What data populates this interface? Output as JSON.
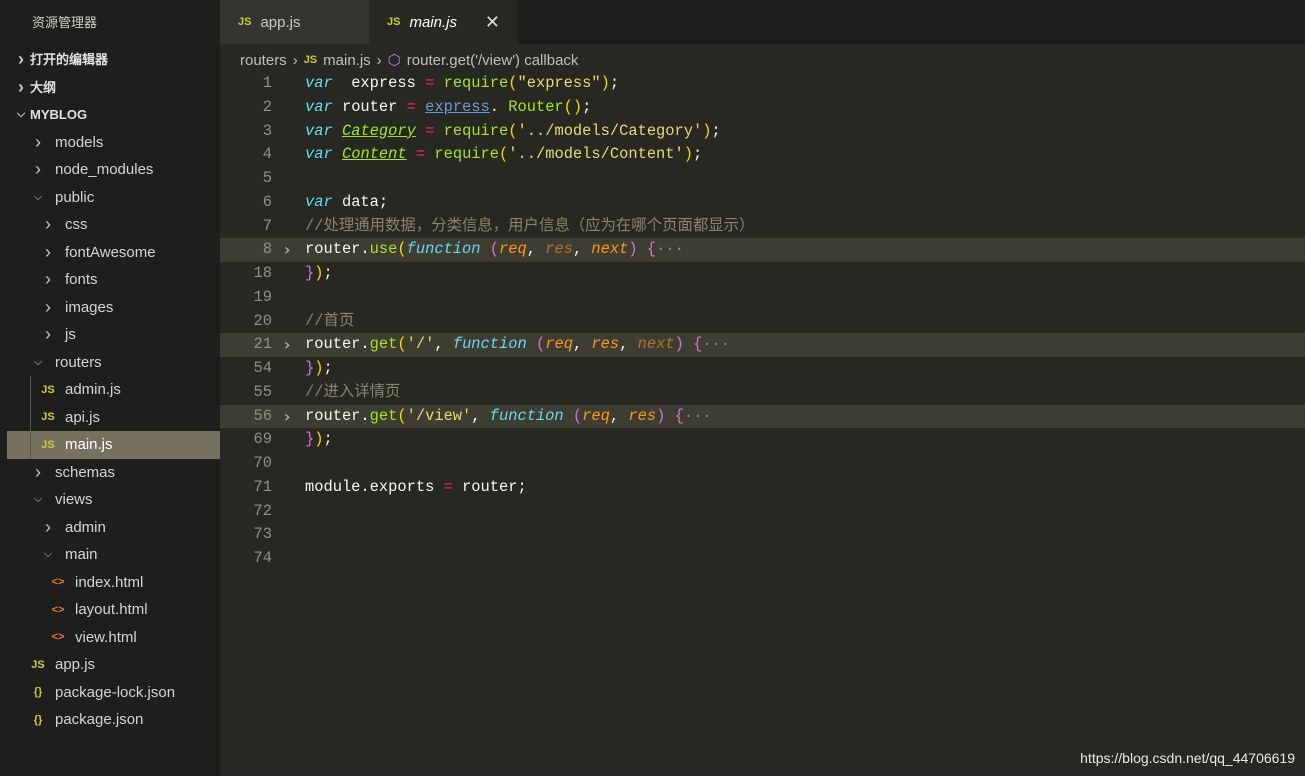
{
  "sidebar": {
    "title": "资源管理器",
    "sections": [
      {
        "label": "打开的编辑器",
        "expanded": false
      },
      {
        "label": "大纲",
        "expanded": false
      },
      {
        "label": "MYBLOG",
        "expanded": true
      }
    ],
    "tree": [
      {
        "label": "models",
        "depth": 1,
        "type": "folder",
        "open": false
      },
      {
        "label": "node_modules",
        "depth": 1,
        "type": "folder",
        "open": false
      },
      {
        "label": "public",
        "depth": 1,
        "type": "folder",
        "open": true
      },
      {
        "label": "css",
        "depth": 2,
        "type": "folder",
        "open": false
      },
      {
        "label": "fontAwesome",
        "depth": 2,
        "type": "folder",
        "open": false
      },
      {
        "label": "fonts",
        "depth": 2,
        "type": "folder",
        "open": false
      },
      {
        "label": "images",
        "depth": 2,
        "type": "folder",
        "open": false
      },
      {
        "label": "js",
        "depth": 2,
        "type": "folder",
        "open": false
      },
      {
        "label": "routers",
        "depth": 1,
        "type": "folder",
        "open": true
      },
      {
        "label": "admin.js",
        "depth": 2,
        "type": "js"
      },
      {
        "label": "api.js",
        "depth": 2,
        "type": "js"
      },
      {
        "label": "main.js",
        "depth": 2,
        "type": "js",
        "selected": true
      },
      {
        "label": "schemas",
        "depth": 1,
        "type": "folder",
        "open": false
      },
      {
        "label": "views",
        "depth": 1,
        "type": "folder",
        "open": true
      },
      {
        "label": "admin",
        "depth": 2,
        "type": "folder",
        "open": false
      },
      {
        "label": "main",
        "depth": 2,
        "type": "folder",
        "open": true
      },
      {
        "label": "index.html",
        "depth": 3,
        "type": "html"
      },
      {
        "label": "layout.html",
        "depth": 3,
        "type": "html"
      },
      {
        "label": "view.html",
        "depth": 3,
        "type": "html"
      },
      {
        "label": "app.js",
        "depth": 1,
        "type": "js"
      },
      {
        "label": "package-lock.json",
        "depth": 1,
        "type": "json"
      },
      {
        "label": "package.json",
        "depth": 1,
        "type": "json"
      }
    ]
  },
  "tabs": [
    {
      "label": "app.js",
      "icon": "JS",
      "active": false
    },
    {
      "label": "main.js",
      "icon": "JS",
      "active": true,
      "close": "✕"
    }
  ],
  "breadcrumb": {
    "folder": "routers",
    "file": "main.js",
    "icon": "JS",
    "symbol": "router.get('/view') callback"
  },
  "code": [
    {
      "n": "1",
      "t": [
        [
          "kw",
          "var"
        ],
        [
          "",
          "  express "
        ],
        [
          "op",
          "="
        ],
        [
          "",
          " "
        ],
        [
          "fn",
          "require"
        ],
        [
          "b2",
          "("
        ],
        [
          "str",
          "\"express\""
        ],
        [
          "b2",
          ")"
        ],
        [
          "",
          ";"
        ]
      ]
    },
    {
      "n": "2",
      "t": [
        [
          "kw",
          "var"
        ],
        [
          "",
          " router "
        ],
        [
          "op",
          "="
        ],
        [
          "",
          " "
        ],
        [
          "ul",
          "express"
        ],
        [
          "",
          ". "
        ],
        [
          "fn",
          "Router"
        ],
        [
          "b2",
          "()"
        ],
        [
          "",
          ";"
        ]
      ]
    },
    {
      "n": "3",
      "t": [
        [
          "kw",
          "var"
        ],
        [
          "",
          " "
        ],
        [
          "cls",
          "Category"
        ],
        [
          "",
          " "
        ],
        [
          "op",
          "="
        ],
        [
          "",
          " "
        ],
        [
          "fn",
          "require"
        ],
        [
          "b2",
          "("
        ],
        [
          "str",
          "'../models/Category'"
        ],
        [
          "b2",
          ")"
        ],
        [
          "",
          ";"
        ]
      ]
    },
    {
      "n": "4",
      "t": [
        [
          "kw",
          "var"
        ],
        [
          "",
          " "
        ],
        [
          "cls",
          "Content"
        ],
        [
          "",
          " "
        ],
        [
          "op",
          "="
        ],
        [
          "",
          " "
        ],
        [
          "fn",
          "require"
        ],
        [
          "b2",
          "("
        ],
        [
          "str",
          "'../models/Content'"
        ],
        [
          "b2",
          ")"
        ],
        [
          "",
          ";"
        ]
      ]
    },
    {
      "n": "5",
      "t": []
    },
    {
      "n": "6",
      "t": [
        [
          "kw",
          "var"
        ],
        [
          "",
          " data;"
        ]
      ]
    },
    {
      "n": "7",
      "t": [
        [
          "cm",
          "//处理通用数据，分类信息，用户信息（应为在哪个页面都显示）"
        ]
      ]
    },
    {
      "n": "8",
      "fold": true,
      "t": [
        [
          "",
          "router."
        ],
        [
          "fn",
          "use"
        ],
        [
          "b2",
          "("
        ],
        [
          "kw",
          "function"
        ],
        [
          "",
          " "
        ],
        [
          "b1",
          "("
        ],
        [
          "p1",
          "req"
        ],
        [
          "",
          ", "
        ],
        [
          "pd",
          "res"
        ],
        [
          "",
          ", "
        ],
        [
          "p1",
          "next"
        ],
        [
          "b1",
          ")"
        ],
        [
          "",
          " "
        ],
        [
          "b1",
          "{"
        ],
        [
          "ell",
          "···"
        ]
      ]
    },
    {
      "n": "18",
      "t": [
        [
          "b1",
          "}"
        ],
        [
          "b2",
          ")"
        ],
        [
          "",
          ";"
        ]
      ]
    },
    {
      "n": "19",
      "t": []
    },
    {
      "n": "20",
      "t": [
        [
          "cm",
          "//首页"
        ]
      ]
    },
    {
      "n": "21",
      "fold": true,
      "t": [
        [
          "",
          "router."
        ],
        [
          "fn",
          "get"
        ],
        [
          "b2",
          "("
        ],
        [
          "str",
          "'/'"
        ],
        [
          "",
          ", "
        ],
        [
          "kw",
          "function"
        ],
        [
          "",
          " "
        ],
        [
          "b1",
          "("
        ],
        [
          "p1",
          "req"
        ],
        [
          "",
          ", "
        ],
        [
          "p1",
          "res"
        ],
        [
          "",
          ", "
        ],
        [
          "pd",
          "next"
        ],
        [
          "b1",
          ")"
        ],
        [
          "",
          " "
        ],
        [
          "b1",
          "{"
        ],
        [
          "ell",
          "···"
        ]
      ]
    },
    {
      "n": "54",
      "t": [
        [
          "b1",
          "}"
        ],
        [
          "b2",
          ")"
        ],
        [
          "",
          ";"
        ]
      ]
    },
    {
      "n": "55",
      "t": [
        [
          "cm",
          "//进入详情页"
        ]
      ]
    },
    {
      "n": "56",
      "fold": true,
      "t": [
        [
          "",
          "router."
        ],
        [
          "fn",
          "get"
        ],
        [
          "b2",
          "("
        ],
        [
          "str",
          "'/view'"
        ],
        [
          "",
          ", "
        ],
        [
          "kw",
          "function"
        ],
        [
          "",
          " "
        ],
        [
          "b1",
          "("
        ],
        [
          "p1",
          "req"
        ],
        [
          "",
          ", "
        ],
        [
          "p1",
          "res"
        ],
        [
          "b1",
          ")"
        ],
        [
          "",
          " "
        ],
        [
          "b1",
          "{"
        ],
        [
          "ell",
          "···"
        ]
      ]
    },
    {
      "n": "69",
      "t": [
        [
          "b1",
          "}"
        ],
        [
          "b2",
          ")"
        ],
        [
          "",
          ";"
        ]
      ]
    },
    {
      "n": "70",
      "t": []
    },
    {
      "n": "71",
      "t": [
        [
          "",
          "module.exports "
        ],
        [
          "op",
          "="
        ],
        [
          "",
          " router;"
        ]
      ]
    },
    {
      "n": "72",
      "t": []
    },
    {
      "n": "73",
      "t": []
    },
    {
      "n": "74",
      "t": []
    }
  ],
  "watermark": "https://blog.csdn.net/qq_44706619",
  "colors": {
    "background": "#272822",
    "sidebar": "#1e1f1c",
    "selection": "#75715e",
    "keyword": "#66d9ef",
    "function": "#a6e22e",
    "string": "#e6db74",
    "operator": "#f92672",
    "comment": "#88846f"
  }
}
